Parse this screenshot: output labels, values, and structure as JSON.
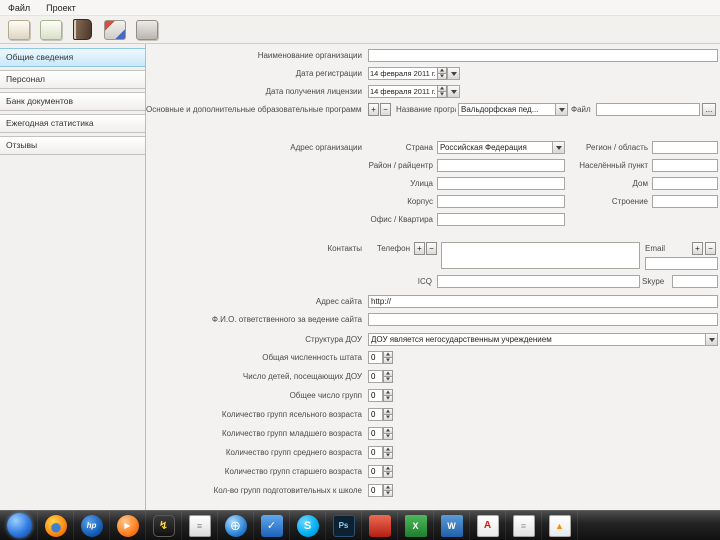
{
  "menu": {
    "items": [
      {
        "label": "Файл"
      },
      {
        "label": "Проект"
      }
    ]
  },
  "toolbar": {
    "buttons": [
      "new-card-icon",
      "edit-card-icon",
      "archive-book-icon",
      "card-index-icon",
      "database-icon"
    ]
  },
  "sidebar": {
    "items": [
      {
        "key": "general",
        "label": "Общие сведения",
        "active": true
      },
      {
        "key": "personnel",
        "label": "Персонал",
        "active": false
      },
      {
        "key": "documents-bank",
        "label": "Банк документов",
        "active": false
      },
      {
        "key": "annual-statistics",
        "label": "Ежегодная статистика",
        "active": false
      },
      {
        "key": "reviews",
        "label": "Отзывы",
        "active": false
      }
    ]
  },
  "form": {
    "org": {
      "label": "Наименование организации",
      "value": ""
    },
    "dates": {
      "registration_label": "Дата регистрации",
      "registration_value": "14 февраля 2011 г.",
      "license_label": "Дата получения лицензии",
      "license_value": "14 февраля 2011 г."
    },
    "programs": {
      "label": "Основные и дополнительные образовательные программы",
      "add_label": "+",
      "remove_label": "−",
      "name_label": "Название программы",
      "value": "Вальдорфская пед...",
      "file_label": "Файл",
      "file_value": "",
      "browse_label": "..."
    },
    "address": {
      "section_label": "Адрес организации",
      "country_label": "Страна",
      "country_value": "Российская Федерация",
      "region_label": "Регион / область",
      "district_label": "Район / райцентр",
      "settlement_label": "Населённый пункт",
      "street_label": "Улица",
      "house_label": "Дом",
      "building_label": "Корпус",
      "structure_label": "Строение",
      "office_label": "Офис / Квартира"
    },
    "contacts": {
      "section_label": "Контакты",
      "phone_label": "Телефон",
      "email_label": "Email",
      "icq_label": "ICQ",
      "skype_label": "Skype",
      "add_label": "+",
      "remove_label": "−"
    },
    "site": {
      "label": "Адрес сайта",
      "value": "http://"
    },
    "webmaster": {
      "label": "Ф.И.О. ответственного за ведение сайта",
      "value": ""
    },
    "structure": {
      "label": "Структура ДОУ",
      "value": "ДОУ является негосударственным учреждением"
    },
    "counters": [
      {
        "label": "Общая численность штата",
        "value": "0"
      },
      {
        "label": "Число детей, посещающих ДОУ",
        "value": "0"
      },
      {
        "label": "Общее число групп",
        "value": "0"
      },
      {
        "label": "Количество групп ясельного возраста",
        "value": "0"
      },
      {
        "label": "Количество групп младшего возраста",
        "value": "0"
      },
      {
        "label": "Количество групп среднего возраста",
        "value": "0"
      },
      {
        "label": "Количество групп старшего возраста",
        "value": "0"
      },
      {
        "label": "Кол-во групп подготовительных к школе",
        "value": "0"
      }
    ]
  },
  "taskbar": {
    "icons": [
      {
        "name": "start-button",
        "style": "ic-start",
        "glyph": ""
      },
      {
        "name": "firefox-icon",
        "style": "ic-firefox",
        "glyph": ""
      },
      {
        "name": "hp-icon",
        "style": "ic-hp",
        "glyph": "hp"
      },
      {
        "name": "media-player-icon",
        "style": "ic-player",
        "glyph": "▶"
      },
      {
        "name": "daemon-tools-icon",
        "style": "ic-daemon",
        "glyph": "↯"
      },
      {
        "name": "notes-icon",
        "style": "ic-notes",
        "glyph": "≡"
      },
      {
        "name": "internet-globe-icon",
        "style": "ic-globe",
        "glyph": "⊕"
      },
      {
        "name": "update-check-icon",
        "style": "ic-check",
        "glyph": "✓"
      },
      {
        "name": "skype-icon",
        "style": "ic-skype",
        "glyph": "S"
      },
      {
        "name": "photoshop-icon",
        "style": "ic-ps",
        "glyph": "Ps"
      },
      {
        "name": "red-app-icon",
        "style": "ic-red",
        "glyph": ""
      },
      {
        "name": "excel-icon",
        "style": "ic-excel",
        "glyph": "X"
      },
      {
        "name": "word-icon",
        "style": "ic-word",
        "glyph": "W"
      },
      {
        "name": "acrobat-reader-icon",
        "style": "ic-pdf",
        "glyph": "A"
      },
      {
        "name": "document-icon",
        "style": "ic-doc",
        "glyph": "≡"
      },
      {
        "name": "image-viewer-icon",
        "style": "ic-pic",
        "glyph": "▲"
      }
    ]
  }
}
